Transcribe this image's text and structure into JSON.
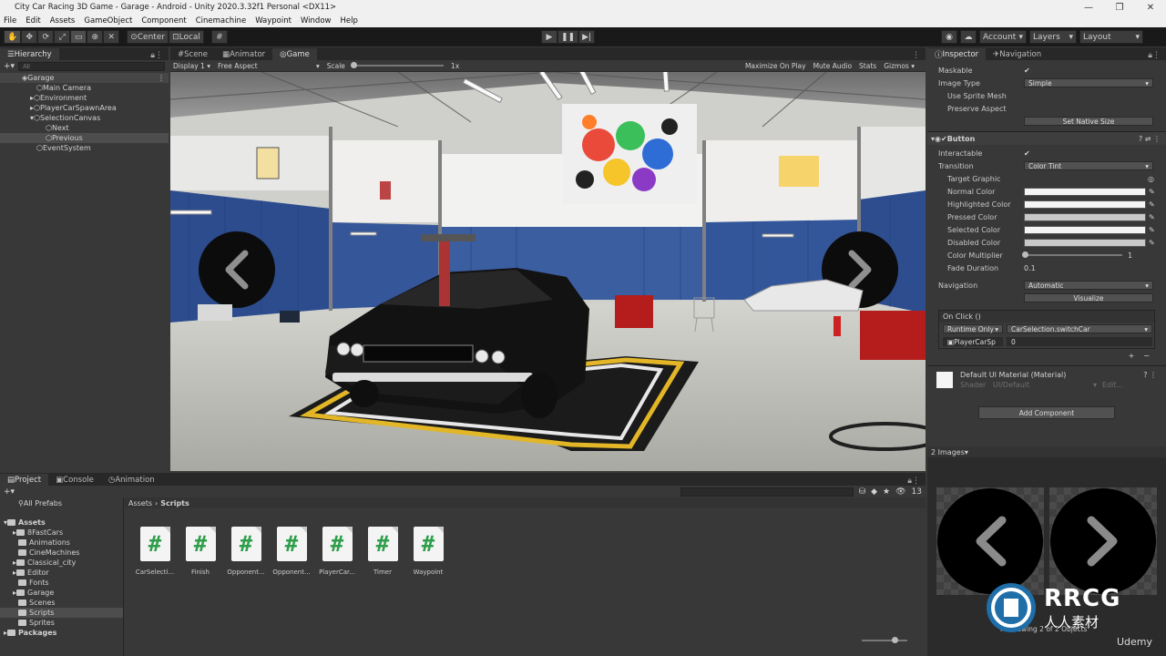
{
  "window": {
    "title": "City Car Racing 3D Game - Garage - Android - Unity 2020.3.32f1 Personal <DX11>",
    "minimize": "—",
    "maximize": "❐",
    "close": "✕"
  },
  "menu": [
    "File",
    "Edit",
    "Assets",
    "GameObject",
    "Component",
    "Cinemachine",
    "Waypoint",
    "Window",
    "Help"
  ],
  "toolbar": {
    "center": "Center",
    "local": "Local",
    "account": "Account",
    "layers": "Layers",
    "layout": "Layout"
  },
  "hierarchy": {
    "tab": "Hierarchy",
    "search_placeholder": "All",
    "scene": "Garage",
    "items": [
      "Main Camera",
      "Environment",
      "PlayerCarSpawnArea",
      "SelectionCanvas",
      "Next",
      "Previous",
      "EventSystem"
    ]
  },
  "center_tabs": {
    "scene": "Scene",
    "animator": "Animator",
    "game": "Game"
  },
  "game_bar": {
    "display": "Display 1",
    "aspect": "Free Aspect",
    "scale_label": "Scale",
    "scale_value": "1x",
    "maximize": "Maximize On Play",
    "mute": "Mute Audio",
    "stats": "Stats",
    "gizmos": "Gizmos"
  },
  "inspector": {
    "tab": "Inspector",
    "tab2": "Navigation",
    "image": {
      "maskable": "Maskable",
      "image_type": "Image Type",
      "image_type_val": "Simple",
      "use_sprite_mesh": "Use Sprite Mesh",
      "preserve_aspect": "Preserve Aspect",
      "set_native": "Set Native Size"
    },
    "button": {
      "header": "Button",
      "interactable": "Interactable",
      "transition": "Transition",
      "transition_val": "Color Tint",
      "target_graphic": "Target Graphic",
      "normal": "Normal Color",
      "highlighted": "Highlighted Color",
      "pressed": "Pressed Color",
      "selected": "Selected Color",
      "disabled": "Disabled Color",
      "multiplier": "Color Multiplier",
      "multiplier_val": "1",
      "fade": "Fade Duration",
      "fade_val": "0.1",
      "navigation": "Navigation",
      "navigation_val": "Automatic",
      "visualize": "Visualize",
      "onclick": "On Click ()",
      "runtime": "Runtime Only",
      "function": "CarSelection.switchCar",
      "object": "PlayerCarSp",
      "arg": "0"
    },
    "material": {
      "name": "Default UI Material (Material)",
      "shader_label": "Shader",
      "shader": "UI/Default",
      "edit": "Edit..."
    },
    "add_component": "Add Component",
    "preview": {
      "label": "2 Images",
      "footer": "Previewing 2 of 2 Objects"
    }
  },
  "bottom_tabs": {
    "project": "Project",
    "console": "Console",
    "animation": "Animation"
  },
  "project": {
    "favorites": "All Prefabs",
    "root": "Assets",
    "folders": [
      "8FastCars",
      "Animations",
      "CineMachines",
      "Classical_city",
      "Editor",
      "Fonts",
      "Garage",
      "Scenes",
      "Scripts",
      "Sprites"
    ],
    "packages": "Packages",
    "breadcrumb": [
      "Assets",
      "Scripts"
    ],
    "count": "13",
    "assets": [
      "CarSelecti...",
      "Finish",
      "Opponent...",
      "Opponent...",
      "PlayerCar...",
      "Timer",
      "Waypoint"
    ]
  },
  "watermark": {
    "brand": "RRCG",
    "sub": "人人素材",
    "udemy": "Udemy"
  }
}
